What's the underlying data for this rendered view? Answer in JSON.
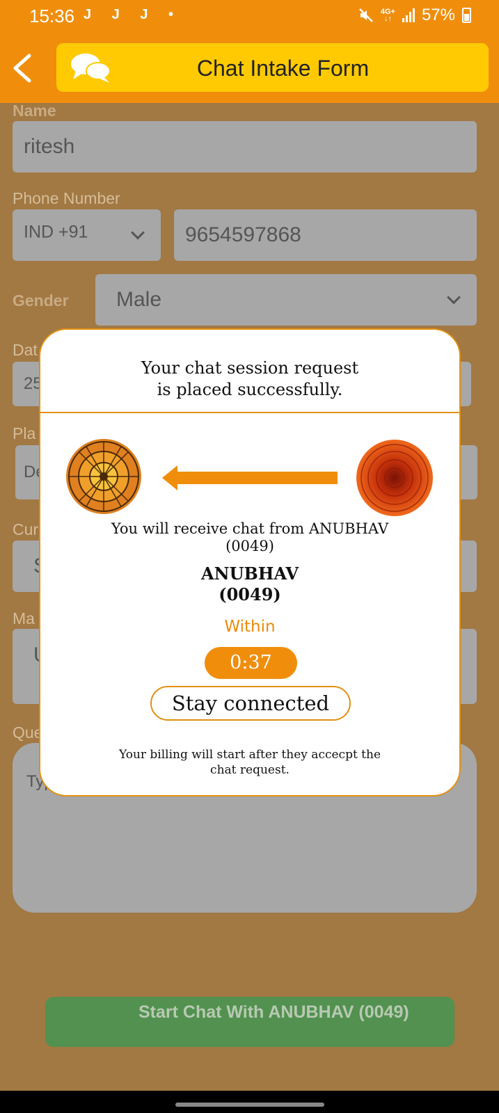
{
  "status_bar": {
    "time": "15:36",
    "notifications": "J J J •",
    "network_top": "4G+",
    "network_bottom": "↓↑",
    "battery": "57%"
  },
  "header": {
    "title": "Chat Intake Form",
    "back_icon": "back-arrow-icon",
    "chat_icon": "chat-bubbles-icon"
  },
  "form": {
    "name_label": "Name",
    "name_value": "ritesh",
    "phone_label": "Phone Number",
    "country_code": "IND +91",
    "phone_value": "9654597868",
    "gender_label": "Gender",
    "gender_value": "Male",
    "date_label_partial": "Dat",
    "date_value_partial": "25",
    "place_label_partial": "Pla",
    "place_value_partial": "De",
    "current_label_partial": "Cur",
    "current_value_partial": "S",
    "marital_label_partial": "Ma",
    "marital_value_partial": "U",
    "question_label_partial": "Que",
    "question_placeholder_partial": "Typ",
    "start_chat_button": "Start Chat With ANUBHAV (0049)"
  },
  "modal": {
    "heading_line1": "Your chat session request",
    "heading_line2": "is placed successfully.",
    "receive_line1": "You will receive chat from ANUBHAV",
    "receive_line2": "(0049)",
    "astrologer_name": "ANUBHAV",
    "astrologer_id": "(0049)",
    "within_label": "Within",
    "timer": "0:37",
    "stay_connected_button": "Stay connected",
    "billing_line1": "Your billing will start after they accecpt the",
    "billing_line2": "chat request."
  },
  "colors": {
    "primary_orange": "#f08e0c",
    "title_yellow": "#ffca02",
    "start_button_green": "#52914f"
  }
}
